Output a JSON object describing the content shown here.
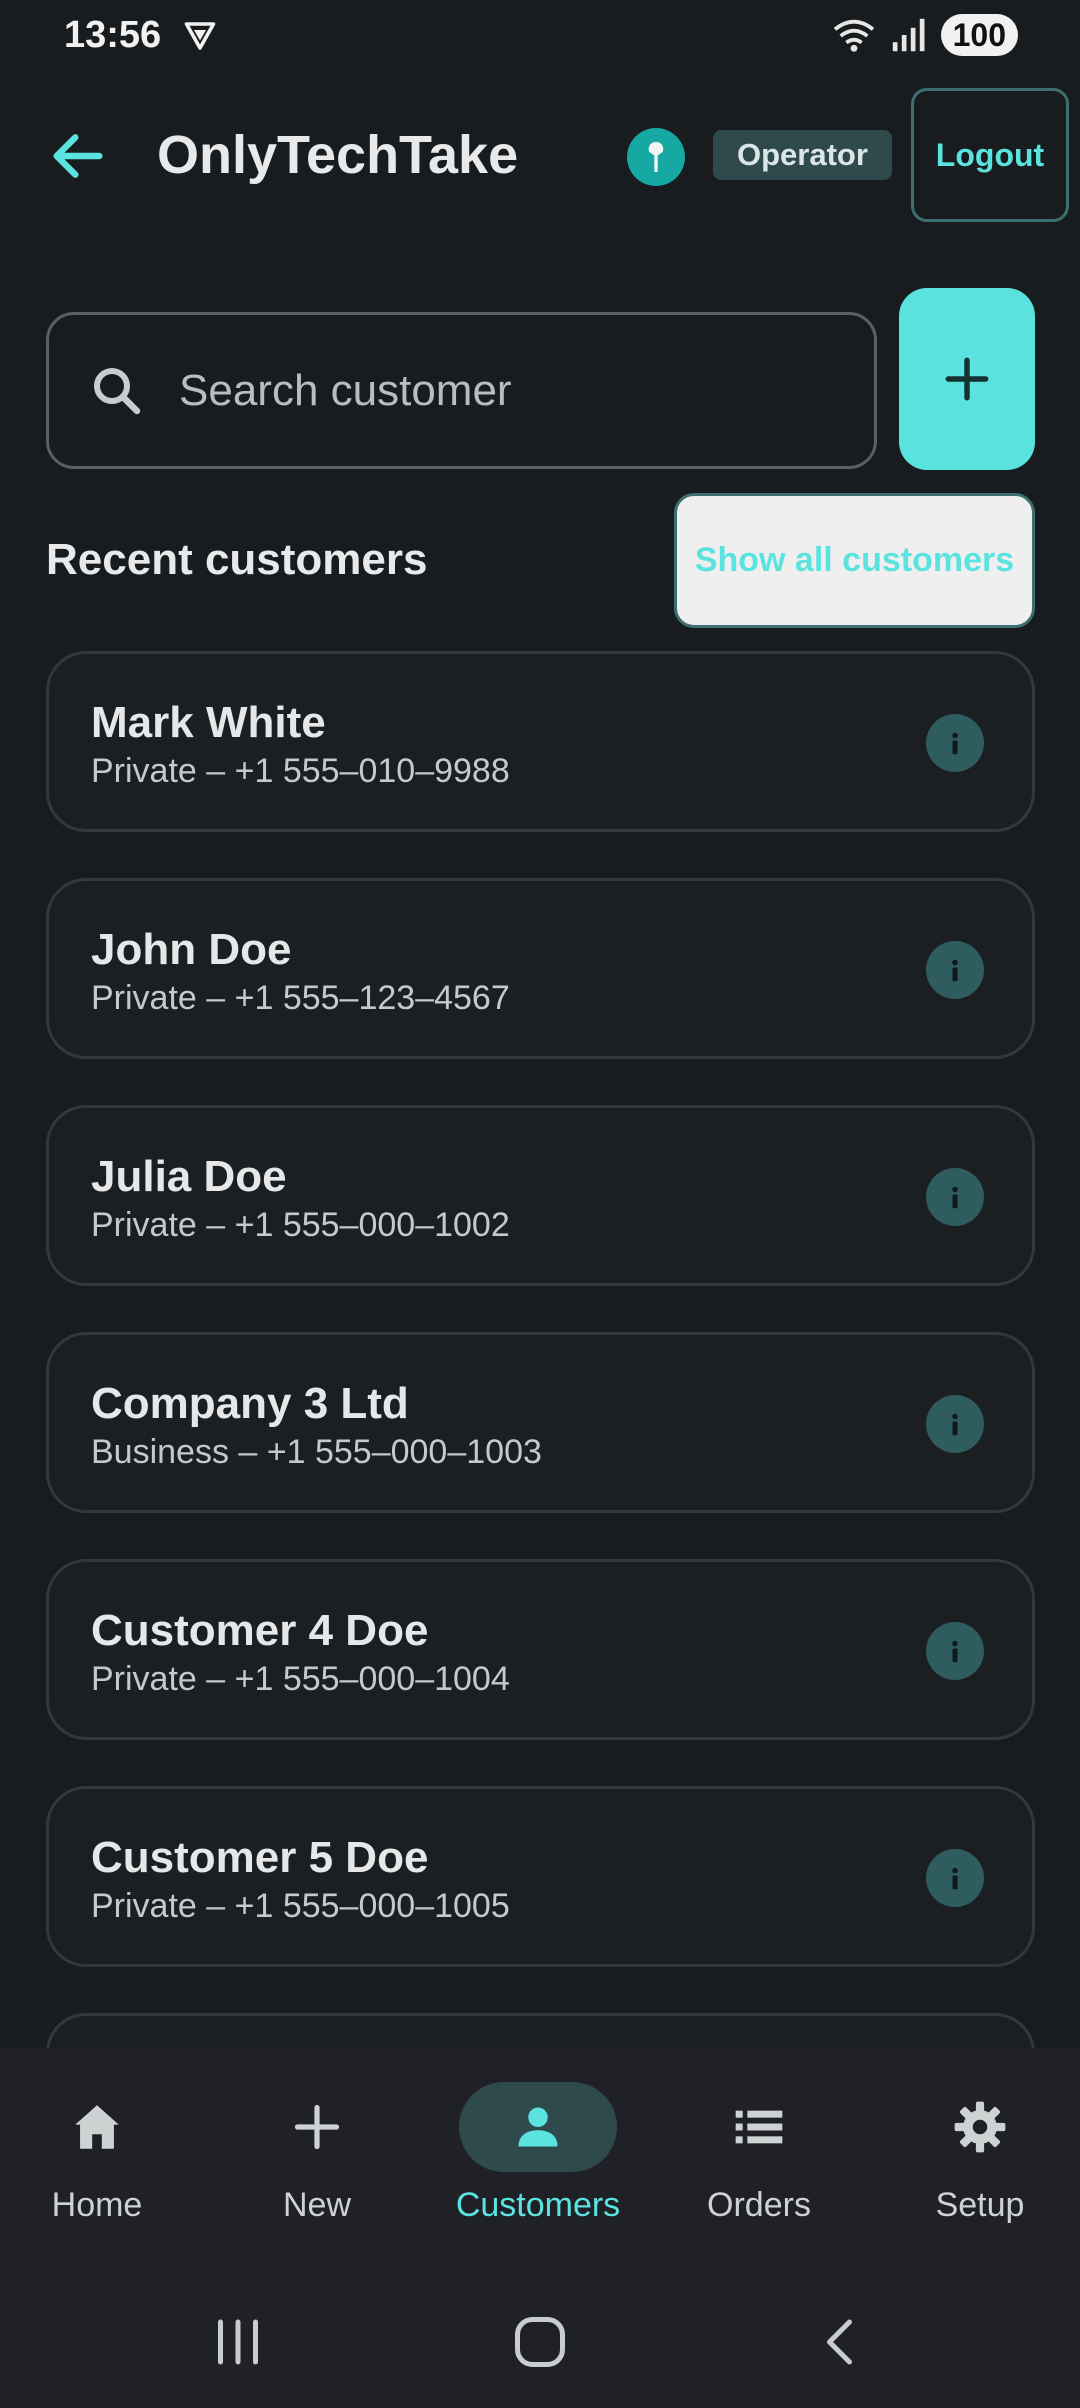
{
  "status_bar": {
    "time": "13:56",
    "battery": "100",
    "icons": [
      "vpn-icon",
      "wifi-icon",
      "signal-icon",
      "battery-icon"
    ]
  },
  "app_bar": {
    "title": "OnlyTechTake",
    "role": "Operator",
    "logout_label": "Logout",
    "accent": "#5ae2de"
  },
  "search": {
    "placeholder": "Search customer",
    "value": ""
  },
  "recent": {
    "title": "Recent customers",
    "show_all_label": "Show all customers"
  },
  "customers": [
    {
      "name": "Mark White",
      "detail": "Private – +1 555–010–9988"
    },
    {
      "name": "John Doe",
      "detail": "Private – +1 555–123–4567"
    },
    {
      "name": "Julia Doe",
      "detail": "Private – +1 555–000–1002"
    },
    {
      "name": "Company 3 Ltd",
      "detail": "Business – +1 555–000–1003"
    },
    {
      "name": "Customer 4 Doe",
      "detail": "Private – +1 555–000–1004"
    },
    {
      "name": "Customer 5 Doe",
      "detail": "Private – +1 555–000–1005"
    }
  ],
  "bottom_nav": {
    "items": [
      {
        "label": "Home",
        "icon": "home-icon"
      },
      {
        "label": "New",
        "icon": "plus-icon"
      },
      {
        "label": "Customers",
        "icon": "person-icon",
        "active": true
      },
      {
        "label": "Orders",
        "icon": "list-icon"
      },
      {
        "label": "Setup",
        "icon": "gear-icon"
      }
    ]
  }
}
